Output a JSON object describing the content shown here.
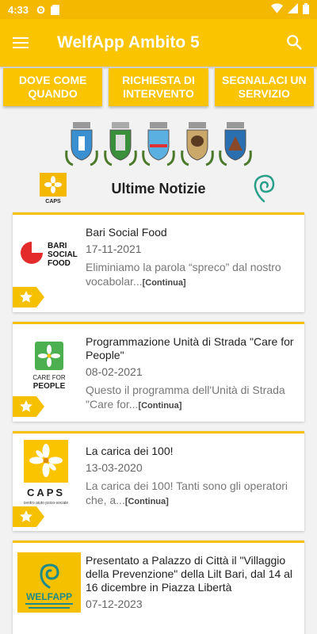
{
  "status": {
    "time": "4:33"
  },
  "appbar": {
    "title": "WelfApp Ambito 5"
  },
  "buttons": {
    "dove": "DOVE COME QUANDO",
    "richiesta": "RICHIESTA DI INTERVENTO",
    "segnalaci": "SEGNALACI UN SERVIZIO"
  },
  "news": {
    "heading": "Ultime Notizie",
    "more": "[Continua]"
  },
  "cards": [
    {
      "title": "Bari Social Food",
      "date": "17-11-2021",
      "desc": "Eliminiamo la parola “spreco” dal nostro vocabolar...",
      "logo": "bari-social-food-logo"
    },
    {
      "title": "Programmazione Unità di Strada \"Care for People\"",
      "date": "08-02-2021",
      "desc": "Questo il programma dell'Unità di Strada \"Care for...",
      "logo": "care-for-people-logo"
    },
    {
      "title": "La carica dei 100!",
      "date": "13-03-2020",
      "desc": "La carica dei 100! Tanti sono gli operatori che, a...",
      "logo": "caps-logo"
    },
    {
      "title": "Presentato a Palazzo di Città il \"Villaggio della Prevenzione\" della Lilt Bari, dal 14 al 16 dicembre in Piazza Libertà",
      "date": "07-12-2023",
      "desc": "",
      "logo": "welfapp-logo"
    }
  ],
  "logos": {
    "bari_line1": "BARI",
    "bari_line2": "SOCIAL",
    "bari_line3": "FOOD",
    "care_line1": "CARE FOR",
    "care_line2": "PEOPLE",
    "caps": "CAPS",
    "caps_sub": "centro aiuto psico-sociale",
    "welfapp": "WELFAPP"
  },
  "colors": {
    "accent": "#fbc400",
    "statusbar": "#f5b800"
  }
}
